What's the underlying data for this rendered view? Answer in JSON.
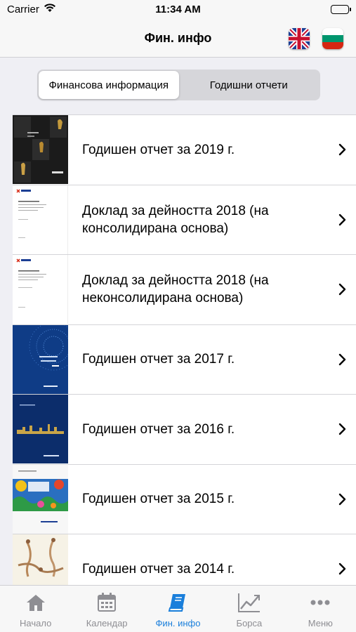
{
  "status_bar": {
    "carrier": "Carrier",
    "time": "11:34 AM"
  },
  "nav": {
    "title": "Фин. инфо"
  },
  "segments": [
    {
      "label": "Финансова информация",
      "active": false
    },
    {
      "label": "Годишни отчети",
      "active": true
    }
  ],
  "reports": [
    {
      "title": "Годишен отчет за 2019 г.",
      "thumb_icon": "annual-report-2019-cover"
    },
    {
      "title": "Доклад за дейността 2018 (на консолидирана основа)",
      "thumb_icon": "activity-report-document"
    },
    {
      "title": "Доклад за дейността 2018 (на неконсолидирана основа)",
      "thumb_icon": "activity-report-document"
    },
    {
      "title": "Годишен отчет за 2017 г.",
      "thumb_icon": "annual-report-2017-cover"
    },
    {
      "title": "Годишен отчет за 2016 г.",
      "thumb_icon": "annual-report-2016-cover"
    },
    {
      "title": "Годишен отчет за 2015 г.",
      "thumb_icon": "annual-report-2015-cover"
    },
    {
      "title": "Годишен отчет за 2014 г.",
      "thumb_icon": "annual-report-2014-cover"
    }
  ],
  "tabs": [
    {
      "label": "Начало",
      "icon": "home-icon",
      "active": false
    },
    {
      "label": "Календар",
      "icon": "calendar-icon",
      "active": false
    },
    {
      "label": "Фин. инфо",
      "icon": "book-icon",
      "active": true
    },
    {
      "label": "Борса",
      "icon": "chart-icon",
      "active": false
    },
    {
      "label": "Меню",
      "icon": "more-icon",
      "active": false
    }
  ],
  "colors": {
    "accent": "#1a7fdb",
    "inactive_tab": "#8e8e93",
    "background": "#efeff4"
  }
}
